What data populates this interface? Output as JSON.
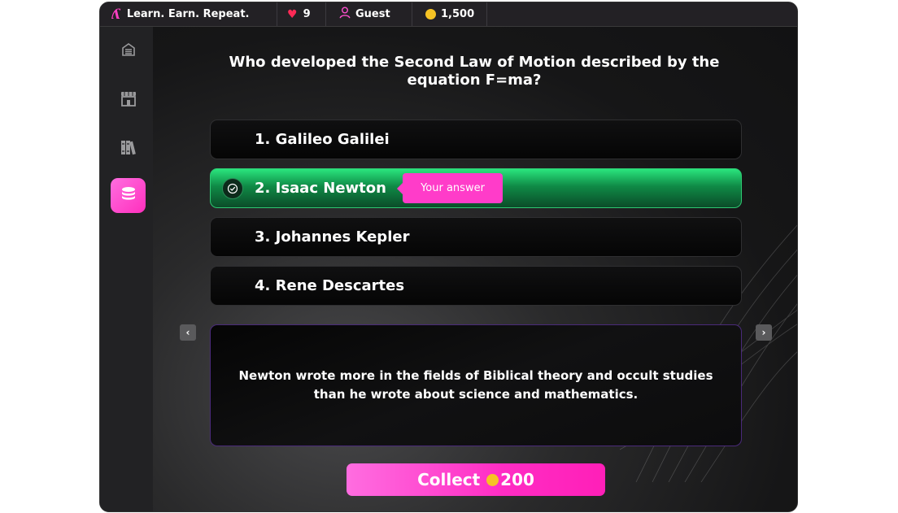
{
  "header": {
    "brand_logo": "ʎ",
    "brand_text": "Learn. Earn. Repeat.",
    "lives": "9",
    "user": "Guest",
    "coins": "1,500"
  },
  "sidebar": {
    "items": [
      {
        "icon": "home-icon",
        "active": false
      },
      {
        "icon": "store-icon",
        "active": false
      },
      {
        "icon": "library-icon",
        "active": false
      },
      {
        "icon": "coins-stack-icon",
        "active": true
      }
    ]
  },
  "quiz": {
    "question": "Who developed the Second Law of Motion described by the equation F=ma?",
    "options": [
      {
        "label": "1. Galileo Galilei"
      },
      {
        "label": "2. Isaac Newton"
      },
      {
        "label": "3. Johannes Kepler"
      },
      {
        "label": "4. Rene Descartes"
      }
    ],
    "your_answer_tag": "Your answer",
    "fact": "Newton wrote more in the fields of Biblical theory and occult studies than he wrote about science and mathematics.",
    "collect_label": "Collect",
    "collect_amount": "200",
    "prev_arrow": "‹",
    "next_arrow": "›"
  },
  "colors": {
    "accent_pink": "#ff3cc9",
    "correct_green": "#1fbf66",
    "coin_gold": "#f6c324",
    "heart_red": "#ff2a56"
  }
}
